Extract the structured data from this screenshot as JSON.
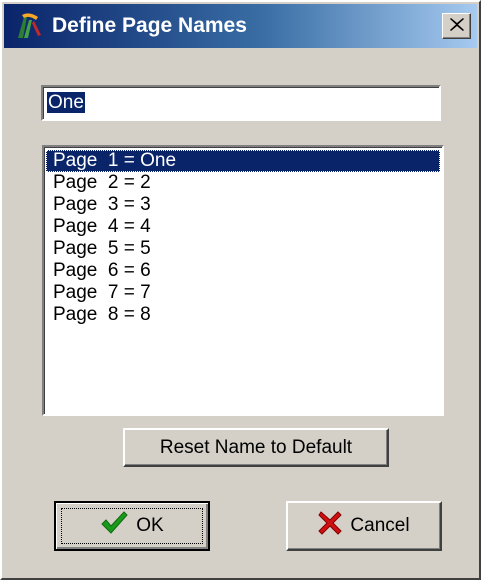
{
  "window": {
    "title": "Define Page Names",
    "close_label": "×"
  },
  "name_field": {
    "value": "One"
  },
  "pages": {
    "items": [
      {
        "label": "Page  1 = One",
        "selected": true
      },
      {
        "label": "Page  2 = 2",
        "selected": false
      },
      {
        "label": "Page  3 = 3",
        "selected": false
      },
      {
        "label": "Page  4 = 4",
        "selected": false
      },
      {
        "label": "Page  5 = 5",
        "selected": false
      },
      {
        "label": "Page  6 = 6",
        "selected": false
      },
      {
        "label": "Page  7 = 7",
        "selected": false
      },
      {
        "label": "Page  8 = 8",
        "selected": false
      }
    ]
  },
  "buttons": {
    "reset_label": "Reset Name to Default",
    "ok_label": "OK",
    "cancel_label": "Cancel"
  },
  "icons": {
    "app": "app-logo-icon",
    "ok": "checkmark-icon",
    "cancel": "x-mark-icon"
  },
  "colors": {
    "selection": "#0a246a",
    "titlebar_start": "#0a246a",
    "titlebar_end": "#a6caf0",
    "ok_check": "#1a9a1a",
    "cancel_x": "#d01010"
  }
}
